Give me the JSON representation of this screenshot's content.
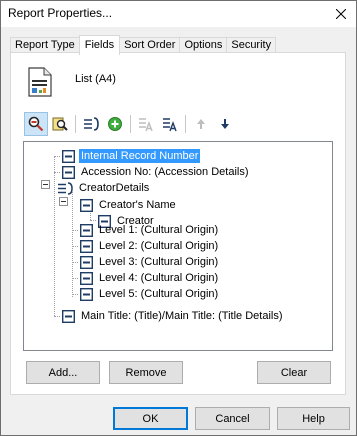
{
  "window": {
    "title": "Report Properties..."
  },
  "tabs": [
    {
      "label": "Report Type",
      "active": false
    },
    {
      "label": "Fields",
      "active": true
    },
    {
      "label": "Sort Order",
      "active": false
    },
    {
      "label": "Options",
      "active": false
    },
    {
      "label": "Security",
      "active": false
    }
  ],
  "report": {
    "layout_name": "List (A4)",
    "icon": "document-chart-icon"
  },
  "toolbar": {
    "items": [
      {
        "icon": "search-field-icon",
        "enabled": true,
        "pressed": true
      },
      {
        "icon": "find-field-icon",
        "enabled": true,
        "pressed": false
      },
      {
        "icon": "group-icon",
        "enabled": true,
        "pressed": false
      },
      {
        "icon": "add-green-icon",
        "enabled": true,
        "pressed": false
      },
      {
        "icon": "field-a-icon",
        "enabled": false,
        "pressed": false
      },
      {
        "icon": "field-a-edit-icon",
        "enabled": true,
        "pressed": false
      },
      {
        "icon": "move-up-icon",
        "enabled": false,
        "pressed": false
      },
      {
        "icon": "move-down-icon",
        "enabled": true,
        "pressed": false
      }
    ]
  },
  "tree": {
    "nodes": [
      {
        "label": "Internal Record Number",
        "icon": "field-icon",
        "selected": true
      },
      {
        "label": "Accession No: (Accession Details)",
        "icon": "field-icon"
      },
      {
        "label": "CreatorDetails",
        "icon": "group-icon",
        "expanded": true
      },
      {
        "label": "Creator's Name",
        "icon": "field-icon",
        "expanded": true
      },
      {
        "label": "Creator",
        "icon": "field-icon"
      },
      {
        "label": "Level 1: (Cultural Origin)",
        "icon": "field-icon"
      },
      {
        "label": "Level 2: (Cultural Origin)",
        "icon": "field-icon"
      },
      {
        "label": "Level 3: (Cultural Origin)",
        "icon": "field-icon"
      },
      {
        "label": "Level 4: (Cultural Origin)",
        "icon": "field-icon"
      },
      {
        "label": "Level 5: (Cultural Origin)",
        "icon": "field-icon"
      },
      {
        "label": "Main Title: (Title)/Main Title: (Title Details)",
        "icon": "field-icon"
      }
    ]
  },
  "panel_buttons": {
    "add": "Add...",
    "remove": "Remove",
    "clear": "Clear"
  },
  "dialog_buttons": {
    "ok": "OK",
    "cancel": "Cancel",
    "help": "Help"
  },
  "colors": {
    "selection": "#3399ff",
    "icon_blue": "#1f3c64",
    "default_button_border": "#0078d7"
  }
}
